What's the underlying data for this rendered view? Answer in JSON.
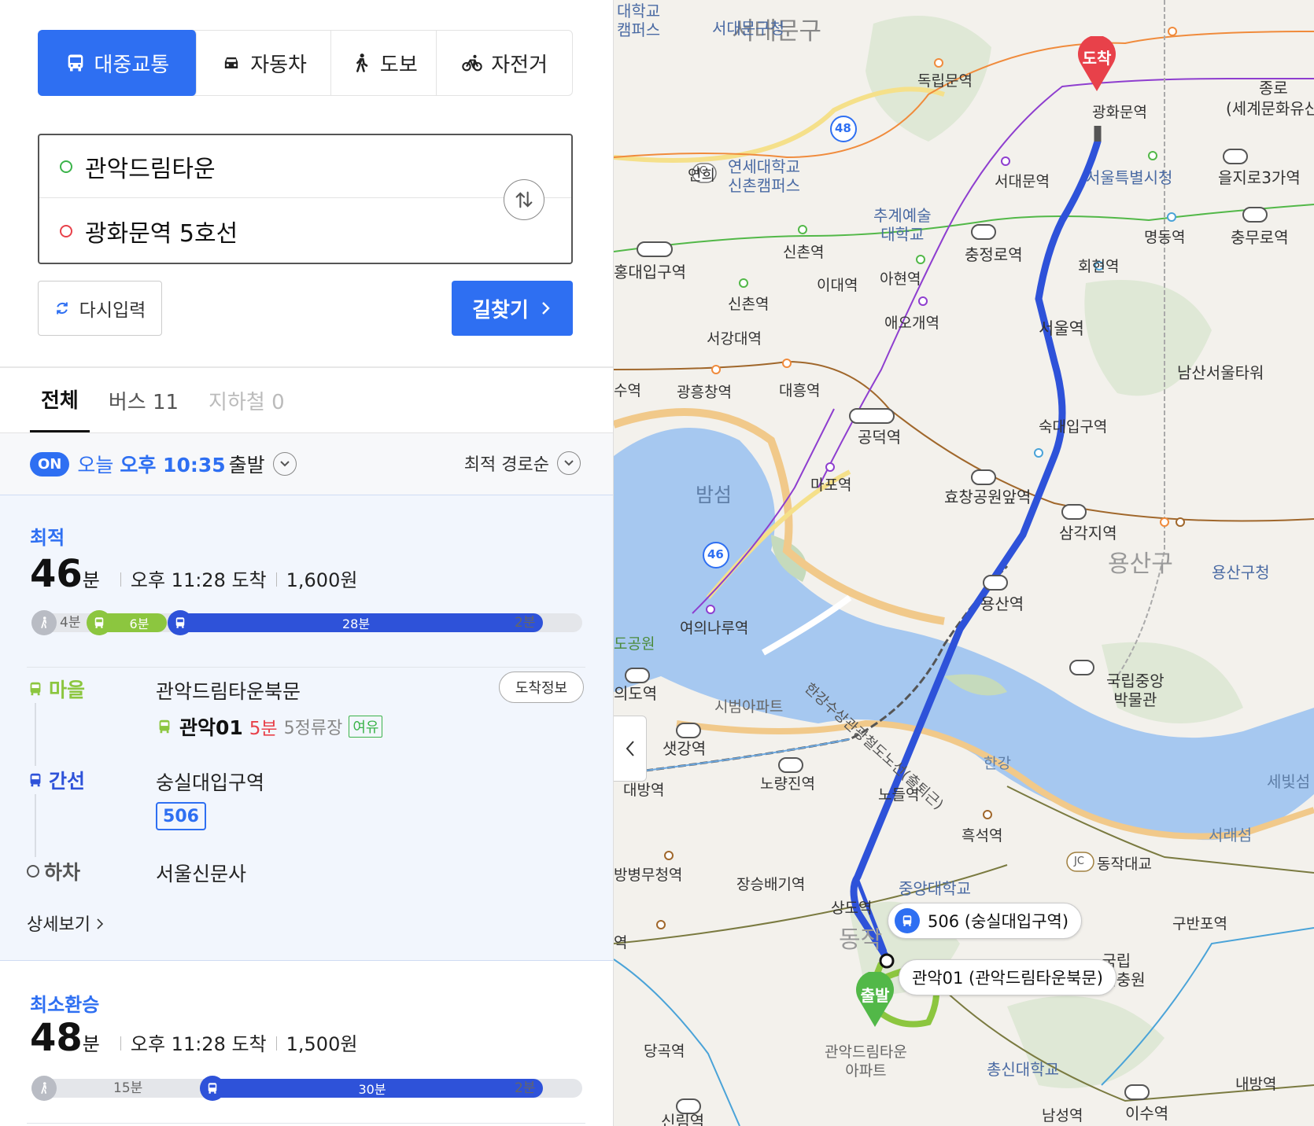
{
  "modes": [
    {
      "label": "대중교통",
      "icon": "bus-icon",
      "active": true
    },
    {
      "label": "자동차",
      "icon": "car-icon",
      "active": false
    },
    {
      "label": "도보",
      "icon": "walk-icon",
      "active": false
    },
    {
      "label": "자전거",
      "icon": "bike-icon",
      "active": false
    }
  ],
  "route": {
    "origin": "관악드림타운",
    "destination": "광화문역 5호선"
  },
  "actions": {
    "reset": "다시입력",
    "find": "길찾기"
  },
  "filters": [
    {
      "label": "전체",
      "state": "active"
    },
    {
      "label": "버스 11",
      "state": "normal"
    },
    {
      "label": "지하철 0",
      "state": "disabled"
    }
  ],
  "departure": {
    "badge": "ON",
    "prefix": "오늘",
    "ampm": "오후 10:35",
    "suffix": "출발",
    "sort": "최적 경로순"
  },
  "result1": {
    "label": "최적",
    "minutes": "46",
    "unit": "분",
    "arrive": "오후 11:28 도착",
    "fare": "1,600원",
    "bar": {
      "walk1": "4분",
      "bus1": "6분",
      "bus2": "28분",
      "walk2": "2분"
    },
    "steps": {
      "s1_type": "마을",
      "s1_stop": "관악드림타운북문",
      "s1_bus": "관악01",
      "s1_eta": "5분",
      "s1_stops": "5정류장",
      "s1_crowd": "여유",
      "arrival_info": "도착정보",
      "s2_type": "간선",
      "s2_stop": "숭실대입구역",
      "s2_bus": "506",
      "s3_type": "하차",
      "s3_stop": "서울신문사"
    },
    "detail": "상세보기"
  },
  "result2": {
    "label": "최소환승",
    "minutes": "48",
    "unit": "분",
    "arrive": "오후 11:28 도착",
    "fare": "1,500원",
    "bar": {
      "walk1": "15분",
      "bus1": "30분",
      "walk2": "2분"
    }
  },
  "colors": {
    "accent": "#2e6ff2",
    "village_bus": "#8cc63f",
    "trunk_bus": "#2e52d9",
    "arrive_pin": "#e8414a",
    "depart_pin": "#52b848"
  },
  "map": {
    "pins": {
      "arrive": "도착",
      "depart": "출발"
    },
    "callouts": {
      "c1": "506 (숭실대입구역)",
      "c2": "관악01 (관악드림타운북문)"
    },
    "labels": {
      "seodaemun_gu": "서대문구",
      "seodaemun_office": "서대문구청",
      "dongnimmun": "독립문역",
      "gwanghwamun": "광화문역",
      "jongno": "종로",
      "heritage": "(세계문화유산",
      "euljiro": "을지로3가역",
      "cityhall": "서울특별시청",
      "seodaemun_st": "서대문역",
      "yonsei": "연세대학교\n신촌캠퍼스",
      "yeonhui": "연희",
      "ic": "IC",
      "chugye": "추계예술\n대학교",
      "sinchon": "신촌역",
      "hongdae": "홍대입구역",
      "chungjeongno": "충정로역",
      "myeongdong": "명동역",
      "chungmuro": "충무로역",
      "hoehyeon": "회현역",
      "edae": "이대역",
      "ahyeon": "아현역",
      "aeogae": "애오개역",
      "seoulst": "서울역",
      "sinchon2": "신촌역",
      "seogang": "서강대역",
      "namsan": "남산서울타워",
      "gwangheung": "광흥창역",
      "daeheung": "대흥역",
      "gongdeok": "공덕역",
      "sookdae": "숙대입구역",
      "su": "수역",
      "bamseom": "밤섬",
      "mapo": "마포역",
      "hyochang": "효창공원앞역",
      "samgakji": "삼각지역",
      "yongsan_gu": "용산구",
      "yongsan_office": "용산구청",
      "yongsan": "용산역",
      "yeouinaru": "여의나루역",
      "park": "도공원",
      "yeouido": "의도역",
      "sibeom": "시범아파트",
      "museum": "국립중앙\n박물관",
      "hangang_train": "한강수상관광철도노선(출퇴근)",
      "hangang": "한강",
      "saetgang": "샛강역",
      "daebang": "대방역",
      "noryangjin": "노량진역",
      "nodeul": "노들역",
      "sebit": "세빛섬",
      "heukseok": "흑석역",
      "seorae": "서래섬",
      "jc": "JC",
      "dongjak_br": "동작대교",
      "byeongmu": "방병무청역",
      "jangseungbaegi": "장승배기역",
      "chungang": "중앙대학교",
      "sangdo": "상도역",
      "dongjak_gu": "동작",
      "gubanpo": "구반포역",
      "cemetery": "국립\n울현충원",
      "yeok": "역",
      "dreamtown": "관악드림타운\n아파트",
      "danggok": "당곡역",
      "chongshin": "총신대학교",
      "naebang": "내방역",
      "namseong": "남성역",
      "isu": "이수역",
      "sillim": "신림역",
      "r48": "48",
      "r46": "46",
      "daehakgyo": "대학교\n캠퍼스"
    }
  }
}
